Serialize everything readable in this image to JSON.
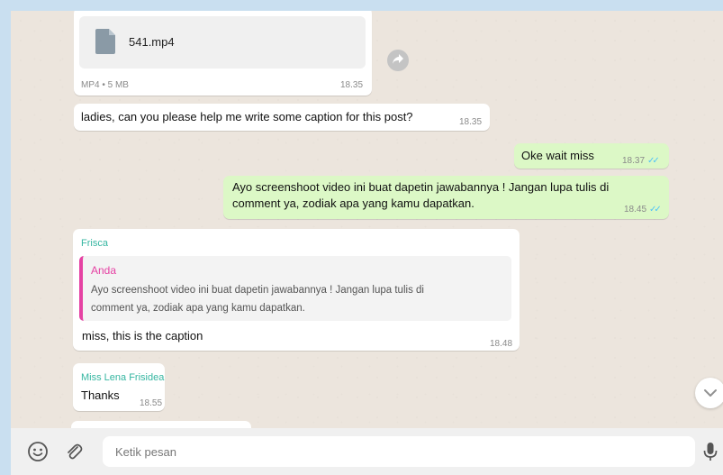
{
  "messages": {
    "file": {
      "file_name": "541.mp4",
      "file_meta": "MP4 • 5 MB",
      "time": "18.35",
      "icon": "file-icon"
    },
    "m1": {
      "text": "ladies, can you please help me write some caption for this post?",
      "time": "18.35"
    },
    "m2": {
      "text": "Oke wait miss",
      "time": "18.37"
    },
    "m3": {
      "line1": "Ayo screenshoot video ini buat dapetin jawabannya ! Jangan lupa tulis di",
      "line2": "comment ya, zodiak apa yang kamu dapatkan.",
      "time": "18.45"
    },
    "m4": {
      "sender": "Frisca",
      "quote_author": "Anda",
      "quote_line1": "Ayo screenshoot video ini buat dapetin jawabannya ! Jangan lupa tulis di",
      "quote_line2": "comment ya, zodiak apa yang kamu dapatkan.",
      "text": "miss, this is the caption",
      "time": "18.48"
    },
    "m5": {
      "sender": "Miss Lena Frisidea",
      "text": "Thanks",
      "time": "18.55"
    }
  },
  "composer": {
    "placeholder": "Ketik pesan"
  },
  "colors": {
    "chat_bg": "#ece5dd",
    "outgoing": "#dcf8c6",
    "incoming": "#ffffff",
    "tick": "#4fc3f7",
    "sender_teal": "#35b6a1",
    "quote_pink": "#e542a3"
  },
  "icons": [
    "share-icon",
    "chevron-down-icon",
    "emoji-icon",
    "attach-icon",
    "mic-icon",
    "double-check-icon"
  ]
}
